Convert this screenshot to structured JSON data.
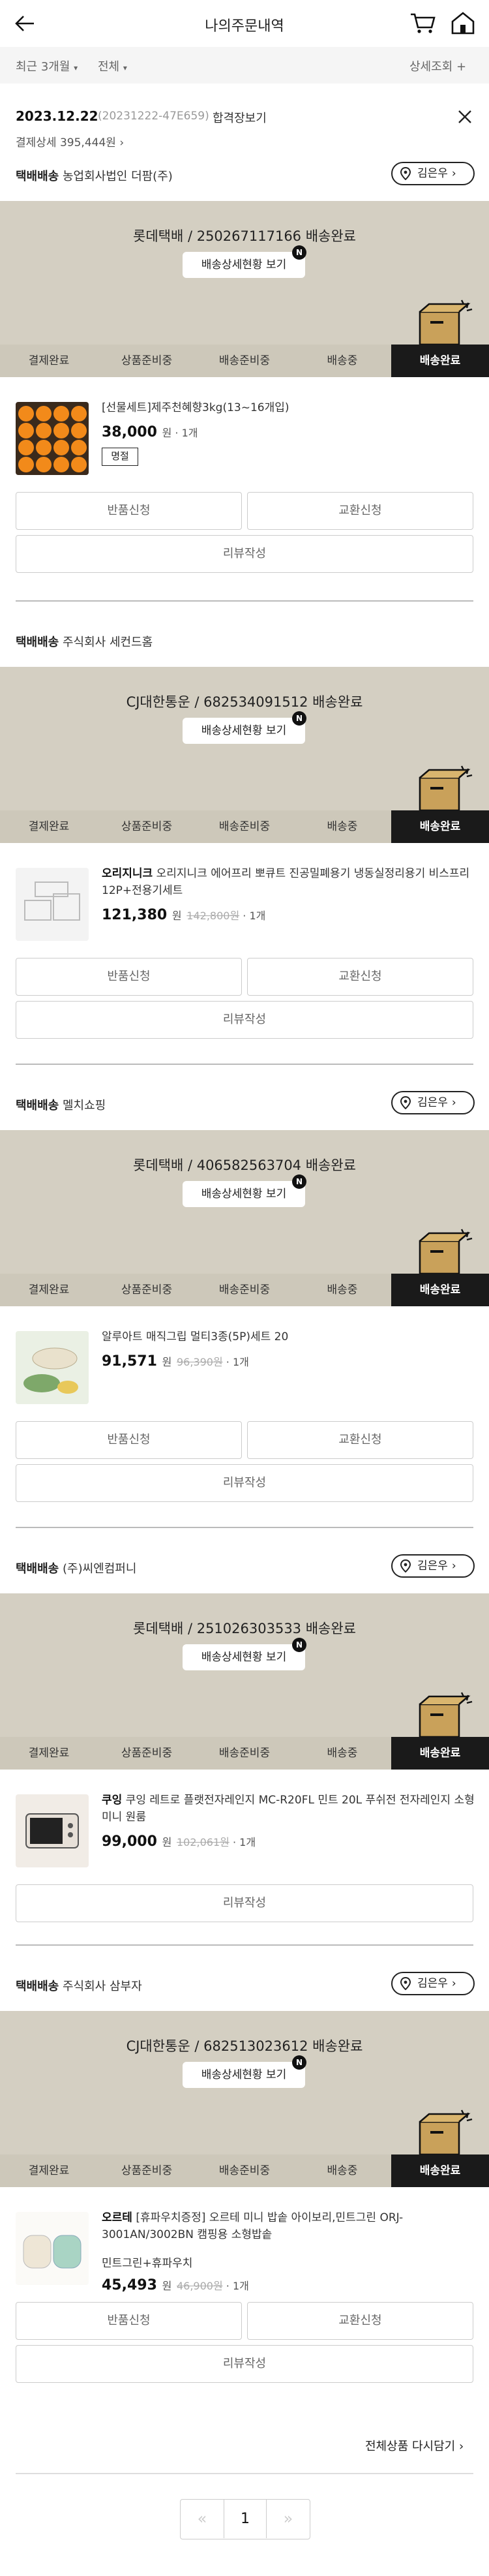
{
  "header": {
    "title": "나의주문내역"
  },
  "filters": {
    "period": "최근 3개월",
    "status": "전체",
    "detail": "상세조회"
  },
  "order": {
    "date": "2023.12.22",
    "order_no": "(20231222-47E659)",
    "state": "합격장보기",
    "payment": "결제상세 395,444원"
  },
  "shipments": [
    {
      "vendor_label": "택배배송",
      "vendor": "농업회사법인 더팜(주)",
      "show_location": true,
      "location": "김은우",
      "carrier": "롯데택배 / 250267117166 배송완료",
      "track_label": "배송상세현황 보기",
      "badge": "N",
      "steps": [
        "결제완료",
        "상품준비중",
        "배송준비중",
        "배송중",
        "배송완료"
      ],
      "product": {
        "brand": "",
        "name": "[선물세트]제주천혜향3kg(13~16개입)",
        "price": "38,000",
        "won": "원",
        "orig": "",
        "qty": "1개",
        "tag": "명절",
        "option": ""
      },
      "buttons": {
        "return": "반품신청",
        "exchange": "교환신청",
        "review": "리뷰작성"
      }
    },
    {
      "vendor_label": "택배배송",
      "vendor": "주식회사 세컨드홈",
      "show_location": false,
      "location": "",
      "carrier": "CJ대한통운 / 682534091512 배송완료",
      "track_label": "배송상세현황 보기",
      "badge": "N",
      "steps": [
        "결제완료",
        "상품준비중",
        "배송준비중",
        "배송중",
        "배송완료"
      ],
      "product": {
        "brand": "오리지니크",
        "name": "오리지니크 에어프리 뽀큐트 진공밀폐용기 냉동실정리용기 비스프리 12P+전용기세트",
        "price": "121,380",
        "won": "원",
        "orig": "142,800원",
        "qty": "1개",
        "tag": "",
        "option": ""
      },
      "buttons": {
        "return": "반품신청",
        "exchange": "교환신청",
        "review": "리뷰작성"
      }
    },
    {
      "vendor_label": "택배배송",
      "vendor": "멜치쇼핑",
      "show_location": true,
      "location": "김은우",
      "carrier": "롯데택배 / 406582563704 배송완료",
      "track_label": "배송상세현황 보기",
      "badge": "N",
      "steps": [
        "결제완료",
        "상품준비중",
        "배송준비중",
        "배송중",
        "배송완료"
      ],
      "product": {
        "brand": "",
        "name": "알루아트 매직그립 멀티3종(5P)세트 20",
        "price": "91,571",
        "won": "원",
        "orig": "96,390원",
        "qty": "1개",
        "tag": "",
        "option": ""
      },
      "buttons": {
        "return": "반품신청",
        "exchange": "교환신청",
        "review": "리뷰작성"
      }
    },
    {
      "vendor_label": "택배배송",
      "vendor": "(주)씨엔컴퍼니",
      "show_location": true,
      "location": "김은우",
      "carrier": "롯데택배 / 251026303533 배송완료",
      "track_label": "배송상세현황 보기",
      "badge": "N",
      "steps": [
        "결제완료",
        "상품준비중",
        "배송준비중",
        "배송중",
        "배송완료"
      ],
      "product": {
        "brand": "쿠잉",
        "name": "쿠잉 레트로 플랫전자레인지 MC-R20FL 민트 20L 푸쉬전 전자레인지 소형 미니 원룸",
        "price": "99,000",
        "won": "원",
        "orig": "102,061원",
        "qty": "1개",
        "tag": "",
        "option": ""
      },
      "buttons": {
        "return": "",
        "exchange": "",
        "review": "리뷰작성"
      }
    },
    {
      "vendor_label": "택배배송",
      "vendor": "주식회사 삼부자",
      "show_location": true,
      "location": "김은우",
      "carrier": "CJ대한통운 / 682513023612 배송완료",
      "track_label": "배송상세현황 보기",
      "badge": "N",
      "steps": [
        "결제완료",
        "상품준비중",
        "배송준비중",
        "배송중",
        "배송완료"
      ],
      "product": {
        "brand": "오르테",
        "name": "[휴파우치증정] 오르테 미니 밥솥 아이보리,민트그린 ORJ-3001AN/3002BN 캠핑용 소형밥솥",
        "price": "45,493",
        "won": "원",
        "orig": "46,900원",
        "qty": "1개",
        "tag": "",
        "option": "민트그린+휴파우치"
      },
      "buttons": {
        "return": "반품신청",
        "exchange": "교환신청",
        "review": "리뷰작성"
      }
    }
  ],
  "footer": {
    "more": "전체상품 다시담기",
    "page": "1",
    "prev": "«",
    "next": "»"
  },
  "colors": {
    "banner": "#d4cfc2",
    "steps": "#cdc8ba",
    "active": "#1a1a1a",
    "box": "#c9a15a"
  }
}
